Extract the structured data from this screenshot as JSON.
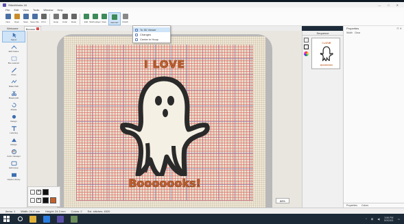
{
  "window": {
    "title": "StitchWorks 18",
    "controls": [
      "—",
      "□",
      "✕"
    ]
  },
  "menu": [
    "File",
    "Edit",
    "View",
    "Tools",
    "Window",
    "Help"
  ],
  "toolbar": {
    "buttons": [
      {
        "name": "new",
        "label": "New",
        "color": "#4a6fa5"
      },
      {
        "name": "open",
        "label": "Open",
        "color": "#c98c2a"
      },
      {
        "name": "save",
        "label": "Save",
        "color": "#4a6fa5"
      },
      {
        "name": "save-file",
        "label": "Save File",
        "color": "#4a6fa5"
      },
      {
        "name": "print",
        "label": "Print",
        "color": "#666666"
      },
      {
        "name": "hoop",
        "label": "Hoop",
        "color": "#777777"
      },
      {
        "name": "undo",
        "label": "Undo",
        "color": "#666666"
      },
      {
        "name": "redo",
        "label": "Redo",
        "color": "#666666"
      },
      {
        "name": "edit",
        "label": "Edit",
        "color": "#3d8a5a"
      },
      {
        "name": "stitch-player",
        "label": "Stitch player",
        "color": "#3d8a5a"
      },
      {
        "name": "view",
        "label": "View",
        "color": "#3d8a5a"
      },
      {
        "name": "import",
        "label": "IMPORT",
        "color": "#3d8a5a"
      },
      {
        "name": "files",
        "label": "FILES",
        "color": "#888888"
      }
    ]
  },
  "dropdown": {
    "items": [
      "To 3D Viewer",
      "Changes",
      "Center in Hoop"
    ]
  },
  "tabs": [
    {
      "label": "Welcome",
      "active": false
    },
    {
      "label": "Booooo",
      "active": true
    }
  ],
  "tools": [
    "Select",
    "Edit Nodes",
    "Box selector",
    "Draw",
    "Make Path",
    "Break path",
    "Rotate",
    "Design",
    "Lettering",
    "Design",
    "Color manager",
    "Edit Hoop",
    "ClipArt Library"
  ],
  "design": {
    "top_text": "I LOVE",
    "bottom_text": "Booooooks!",
    "text_color": "#c4612a",
    "ghost_color": "#2a2a2a"
  },
  "zoom": "88%",
  "palette": {
    "swatches": [
      "#111111",
      "#c4612a"
    ]
  },
  "sequence": {
    "title": "Sequence",
    "thumb_top": "I LOVE",
    "thumb_bottom": "BOOOOOKS"
  },
  "properties": {
    "title": "Properties",
    "sub": [
      "Width",
      "Clear"
    ],
    "bottom_tabs": [
      "Properties",
      "Colors"
    ]
  },
  "status": {
    "items": [
      "Items: 1",
      "Width: 24.4 mm",
      "Height: 24.3 mm",
      "Colors: 2",
      "Est. stitches: 4520"
    ]
  },
  "taskbar": {
    "apps": [
      {
        "name": "file-explorer",
        "color": "#e0b23a"
      },
      {
        "name": "browser",
        "color": "#2b7de0"
      },
      {
        "name": "stitch-app",
        "color": "#5a4fa8"
      },
      {
        "name": "game-app",
        "color": "#6a8c5a"
      }
    ],
    "time": "3:56 PM",
    "date": "5/3/2021"
  }
}
